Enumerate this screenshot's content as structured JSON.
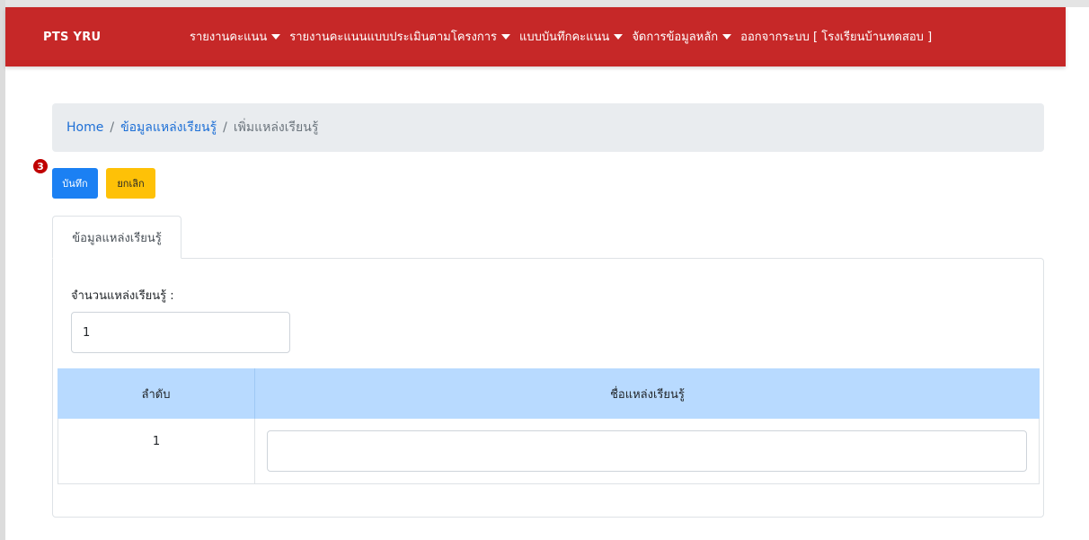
{
  "navbar": {
    "brand": "PTS YRU",
    "menu": [
      {
        "label": "รายงานคะแนน",
        "has_dropdown": true
      },
      {
        "label": "รายงานคะแนนแบบประเมินตามโครงการ",
        "has_dropdown": true
      },
      {
        "label": "แบบบันทึกคะแนน",
        "has_dropdown": true
      },
      {
        "label": "จัดการข้อมูลหลัก",
        "has_dropdown": true
      },
      {
        "label": "ออกจากระบบ [ โรงเรียนบ้านทดสอบ ]",
        "has_dropdown": false
      }
    ]
  },
  "breadcrumb": {
    "home": "Home",
    "section": "ข้อมูลแหล่งเรียนรู้",
    "current": "เพิ่มแหล่งเรียนรู้",
    "separator": "/"
  },
  "annotation": {
    "step_number": "3"
  },
  "toolbar": {
    "save_label": "บันทึก",
    "cancel_label": "ยกเลิก"
  },
  "tabs": [
    {
      "label": "ข้อมูลแหล่งเรียนรู้",
      "active": true
    }
  ],
  "form": {
    "count_label": "จำนวนแหล่งเรียนรู้ :",
    "count_value": "1"
  },
  "table": {
    "headers": [
      "ลำดับ",
      "ชื่อแหล่งเรียนรู้"
    ],
    "rows": [
      {
        "index": "1",
        "name": ""
      }
    ]
  },
  "colors": {
    "navbar": "#c62828",
    "save_button": "#1b80f3",
    "cancel_button": "#fec107",
    "table_header": "#b8daff",
    "breadcrumb_bg": "#e9ecef",
    "step_badge": "#c00000"
  },
  "icons": {
    "dropdown": "caret-down-icon"
  }
}
